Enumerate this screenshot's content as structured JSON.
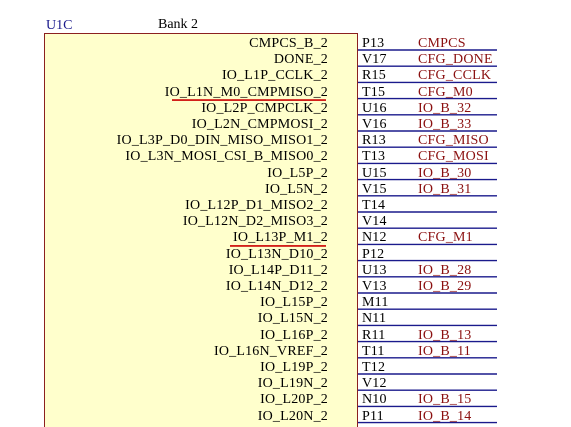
{
  "part": {
    "ref": "U1C",
    "bank": "Bank 2"
  },
  "colors": {
    "body_fill": "#ffffcc",
    "body_border": "#8b2020",
    "pin_line": "#1a1a8c",
    "net_text": "#8b1010",
    "highlight": "#cc0000"
  },
  "pins": [
    {
      "name": "CMPCS_B_2",
      "pin": "P13",
      "net": "CMPCS"
    },
    {
      "name": "DONE_2",
      "pin": "V17",
      "net": "CFG_DONE"
    },
    {
      "name": "IO_L1P_CCLK_2",
      "pin": "R15",
      "net": "CFG_CCLK"
    },
    {
      "name": "IO_L1N_M0_CMPMISO_2",
      "pin": "T15",
      "net": "CFG_M0"
    },
    {
      "name": "IO_L2P_CMPCLK_2",
      "pin": "U16",
      "net": "IO_B_32"
    },
    {
      "name": "IO_L2N_CMPMOSI_2",
      "pin": "V16",
      "net": "IO_B_33"
    },
    {
      "name": "IO_L3P_D0_DIN_MISO_MISO1_2",
      "pin": "R13",
      "net": "CFG_MISO"
    },
    {
      "name": "IO_L3N_MOSI_CSI_B_MISO0_2",
      "pin": "T13",
      "net": "CFG_MOSI"
    },
    {
      "name": "IO_L5P_2",
      "pin": "U15",
      "net": "IO_B_30"
    },
    {
      "name": "IO_L5N_2",
      "pin": "V15",
      "net": "IO_B_31"
    },
    {
      "name": "IO_L12P_D1_MISO2_2",
      "pin": "T14",
      "net": ""
    },
    {
      "name": "IO_L12N_D2_MISO3_2",
      "pin": "V14",
      "net": ""
    },
    {
      "name": "IO_L13P_M1_2",
      "pin": "N12",
      "net": "CFG_M1"
    },
    {
      "name": "IO_L13N_D10_2",
      "pin": "P12",
      "net": ""
    },
    {
      "name": "IO_L14P_D11_2",
      "pin": "U13",
      "net": "IO_B_28"
    },
    {
      "name": "IO_L14N_D12_2",
      "pin": "V13",
      "net": "IO_B_29"
    },
    {
      "name": "IO_L15P_2",
      "pin": "M11",
      "net": ""
    },
    {
      "name": "IO_L15N_2",
      "pin": "N11",
      "net": ""
    },
    {
      "name": "IO_L16P_2",
      "pin": "R11",
      "net": "IO_B_13"
    },
    {
      "name": "IO_L16N_VREF_2",
      "pin": "T11",
      "net": "IO_B_11"
    },
    {
      "name": "IO_L19P_2",
      "pin": "T12",
      "net": ""
    },
    {
      "name": "IO_L19N_2",
      "pin": "V12",
      "net": ""
    },
    {
      "name": "IO_L20P_2",
      "pin": "N10",
      "net": "IO_B_15"
    },
    {
      "name": "IO_L20N_2",
      "pin": "P11",
      "net": "IO_B_14"
    }
  ]
}
